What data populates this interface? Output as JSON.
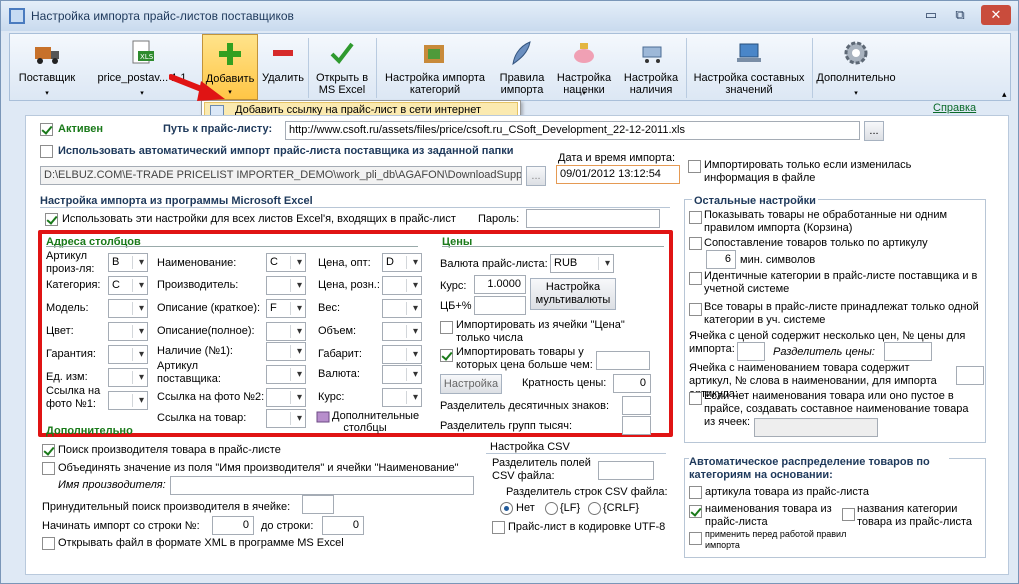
{
  "window": {
    "title": "Настройка импорта прайс-листов поставщиков",
    "min": "▭",
    "restore": "⧉",
    "close": "✕"
  },
  "ribbon": {
    "supplier": "Поставщик",
    "price_file": "price_postav... 1 1",
    "add": "Добавить",
    "remove": "Удалить",
    "open_excel": "Открыть в MS Excel",
    "cat_import": "Настройка импорта категорий",
    "goods_rules": "Правила импорта",
    "markup": "Настройка наценки",
    "stock": "Настройка наличия",
    "composite": "Настройка составных значений",
    "more": "Дополнительно",
    "dd": "▾",
    "collapse": "▴"
  },
  "menu": {
    "add_link": "Добавить ссылку на прайс-лист в сети интернет"
  },
  "help": "Справка",
  "top": {
    "active": "Активен",
    "path_label": "Путь к прайс-листу:",
    "path": "http://www.csoft.ru/assets/files/price/csoft.ru_CSoft_Development_22-12-2011.xls",
    "browse": "...",
    "auto_import": "Использовать автоматический импорт прайс-листа поставщика из заданной папки",
    "folder": "D:\\ELBUZ.COM\\E-TRADE PRICELIST IMPORTER_DEMO\\work_pli_db\\AGAFON\\DownloadSupplyPrices",
    "browse2": "...",
    "dt_label": "Дата и время импорта:",
    "dt": "09/01/2012 13:12:54",
    "only_changed": "Импортировать только если изменилась информация в файле"
  },
  "excel": {
    "title": "Настройка импорта из программы Microsoft Excel",
    "use_all": "Использовать эти настройки для всех листов Excel'я, входящих в прайс-лист",
    "password": "Пароль:"
  },
  "cols": {
    "title": "Адреса столбцов",
    "sku": "Артикул произ-ля:",
    "sku_v": "B",
    "category": "Категория:",
    "category_v": "C",
    "model": "Модель:",
    "color": "Цвет:",
    "warranty": "Гарантия:",
    "unit": "Ед. изм:",
    "photo1": "Ссылка на фото №1:",
    "name": "Наименование:",
    "name_v": "C",
    "maker": "Производитель:",
    "desc_short": "Описание (краткое):",
    "desc_short_v": "F",
    "desc_full": "Описание(полное):",
    "avail": "Наличие (№1):",
    "sup_sku": "Артикул поставщика:",
    "photo2": "Ссылка на фото №2:",
    "link": "Ссылка на товар:",
    "price_opt": "Цена, опт:",
    "price_opt_v": "D",
    "price_ret": "Цена, розн.:",
    "weight": "Вес:",
    "volume": "Объем:",
    "size": "Габарит:",
    "currency": "Валюта:",
    "rate": "Курс:",
    "extra_cols": "Дополнительные столбцы"
  },
  "prices": {
    "title": "Цены",
    "cur_label": "Валюта прайс-листа:",
    "cur": "RUB",
    "rate_label": "Курс:",
    "rate": "1.0000",
    "cb_label": "ЦБ+%",
    "multi": "Настройка мультивалюты",
    "from_cell": "Импортировать из ячейки \"Цена\" только числа",
    "gt": "Импортировать товары у которых цена больше чем:",
    "setup": "Настройка",
    "mult_label": "Кратность цены:",
    "mult": "0",
    "dec_sep": "Разделитель десятичных знаков:",
    "grp_sep": "Разделитель групп тысяч:"
  },
  "extra": {
    "title": "Дополнительно",
    "find_maker": "Поиск производителя товара в прайс-листе",
    "merge": "Объединять значение из поля \"Имя производителя\" и ячейки \"Наименование\"",
    "maker_name": "Имя производителя:",
    "force": "Принудительный поиск производителя в ячейке:",
    "start": "Начинать импорт со строки №:",
    "start_v": "0",
    "to": "до строки:",
    "to_v": "0",
    "xml": "Открывать файл в формате XML в программе MS Excel"
  },
  "csv": {
    "title": "Настройка CSV",
    "fields": "Разделитель полей CSV файла:",
    "rows": "Разделитель строк CSV файла:",
    "none": "Нет",
    "lf": "{LF}",
    "crlf": "{CRLF}",
    "utf8": "Прайс-лист в кодировке UTF-8"
  },
  "other": {
    "title": "Остальные настройки",
    "not_processed": "Показывать товары не обработанные ни одним правилом импорта (Корзина)",
    "match_sku": "Сопоставление товаров только по артикулу",
    "min_v": "6",
    "min_label": "мин. символов",
    "same_cat": "Идентичные категории в прайс-листе поставщика и в учетной системе",
    "one_cat": "Все товары в прайс-листе принадлежат только одной категории в уч. системе",
    "multi_price": "Ячейка с ценой содержит несколько цен, № цены для импорта:",
    "price_sep": "Разделитель цены:",
    "name_sku": "Ячейка с наименованием товара содержит артикул, № слова в наименовании, для импорта артикула:",
    "no_name": "Если нет наименования товара или оно пустое в прайсе, создавать составное наименование товара из ячеек:"
  },
  "auto": {
    "title": "Автоматическое распределение товаров по категориям на основании:",
    "sku": "артикула товара из прайс-листа",
    "name": "наименования товара из прайс-листа",
    "cat": "названия категории товара из прайс-листа",
    "apply": "применить перед работой правил импорта"
  }
}
